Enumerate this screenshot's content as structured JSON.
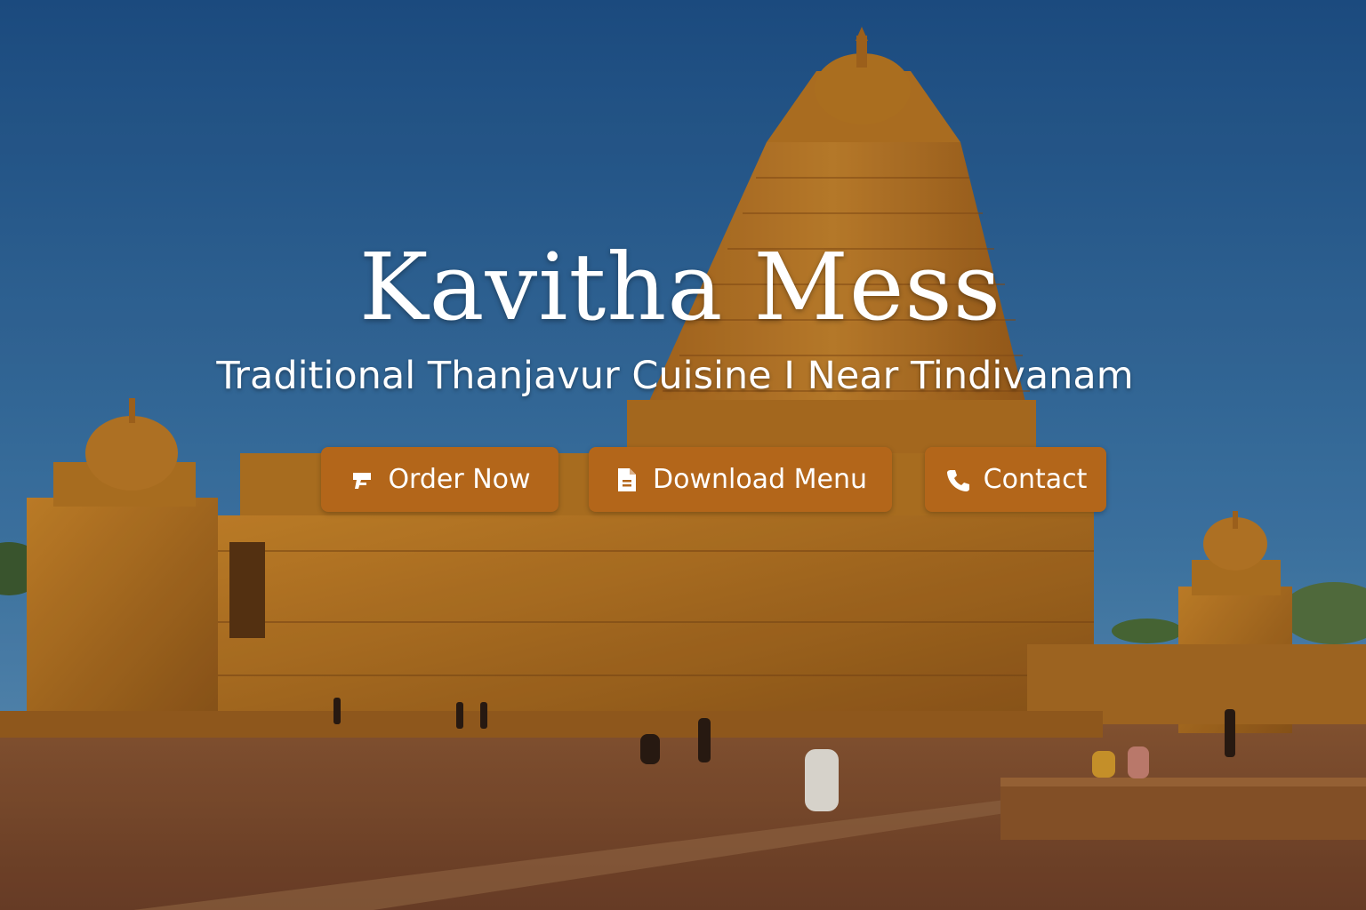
{
  "hero": {
    "title": "Kavitha Mess",
    "subtitle": "Traditional Thanjavur Cuisine I Near Tindivanam",
    "background": "temple-photo",
    "colors": {
      "button": "#b3661a",
      "text": "#ffffff",
      "sky_top": "#1d4f86",
      "sky_bottom": "#5b8fb6",
      "stone": "#b8741d",
      "ground": "#7b4a2b"
    }
  },
  "buttons": [
    {
      "label": "Order Now",
      "icon": "food-order-icon"
    },
    {
      "label": "Download Menu",
      "icon": "document-icon"
    },
    {
      "label": "Contact",
      "icon": "phone-icon"
    }
  ]
}
